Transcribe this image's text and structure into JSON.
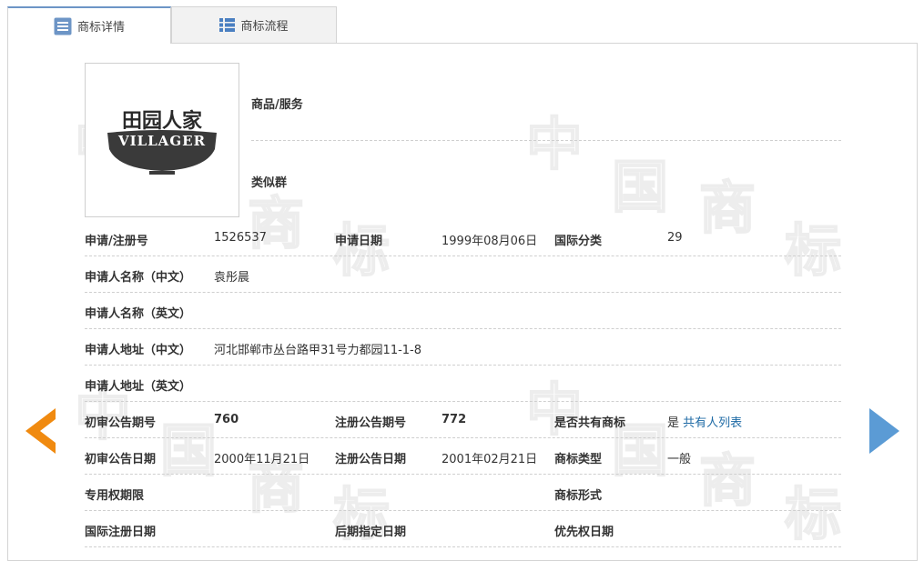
{
  "tabs": [
    {
      "label": "商标详情",
      "active": true
    },
    {
      "label": "商标流程",
      "active": false
    }
  ],
  "watermark": {
    "chars": [
      "中",
      "国",
      "商",
      "标"
    ]
  },
  "logo": {
    "chinese": "田园人家",
    "english": "VILLAGER"
  },
  "goods_services": {
    "label": "商品/服务",
    "value": ""
  },
  "similar_group": {
    "label": "类似群",
    "value": ""
  },
  "fields": {
    "reg_no": {
      "label": "申请/注册号",
      "value": "1526537"
    },
    "app_date": {
      "label": "申请日期",
      "value": "1999年08月06日"
    },
    "intl_class": {
      "label": "国际分类",
      "value": "29"
    },
    "applicant_cn": {
      "label": "申请人名称（中文）",
      "value": "袁彤晨"
    },
    "applicant_en": {
      "label": "申请人名称（英文）",
      "value": ""
    },
    "address_cn": {
      "label": "申请人地址（中文）",
      "value": "河北邯郸市丛台路甲31号力都园11-1-8"
    },
    "address_en": {
      "label": "申请人地址（英文）",
      "value": ""
    },
    "prelim_pub_no": {
      "label": "初审公告期号",
      "value": "760"
    },
    "reg_pub_no": {
      "label": "注册公告期号",
      "value": "772"
    },
    "shared": {
      "label": "是否共有商标",
      "value": "是",
      "link": "共有人列表"
    },
    "prelim_pub_date": {
      "label": "初审公告日期",
      "value": "2000年11月21日"
    },
    "reg_pub_date": {
      "label": "注册公告日期",
      "value": "2001年02月21日"
    },
    "mark_type": {
      "label": "商标类型",
      "value": "一般"
    },
    "exclusive_period": {
      "label": "专用权期限",
      "value": ""
    },
    "mark_form": {
      "label": "商标形式",
      "value": ""
    },
    "intl_reg_date": {
      "label": "国际注册日期",
      "value": ""
    },
    "later_designation_date": {
      "label": "后期指定日期",
      "value": ""
    },
    "priority_date": {
      "label": "优先权日期",
      "value": ""
    }
  },
  "colors": {
    "prev_arrow": "#f08a10",
    "next_arrow": "#5b9bd5",
    "tab_accent": "#6d95c6",
    "link": "#1e6aa5"
  }
}
